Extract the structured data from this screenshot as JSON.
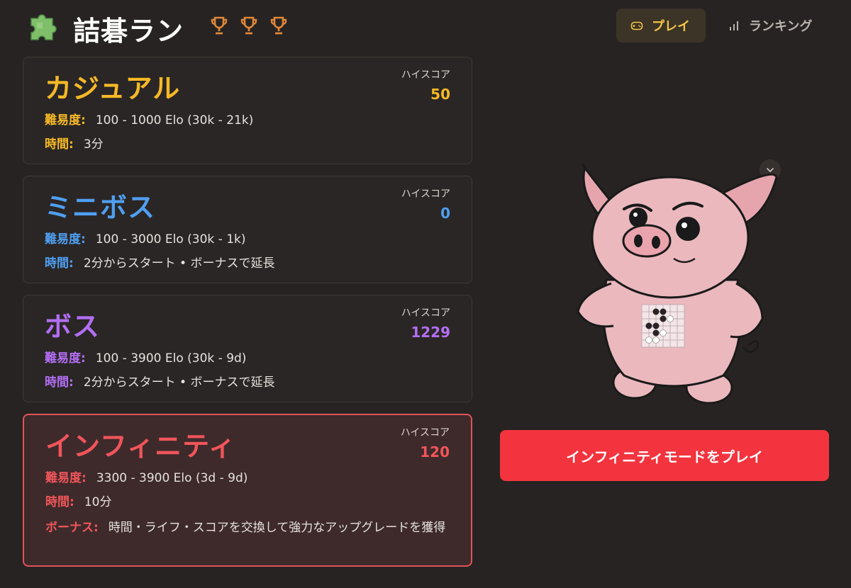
{
  "header": {
    "title": "詰碁ラン",
    "logo_icon": "puzzle-piece-icon",
    "trophy_icon": "trophy-icon",
    "trophy_color": "#e0873a",
    "nav": {
      "play_label": "プレイ",
      "play_icon": "gamepad-icon",
      "ranking_label": "ランキング",
      "ranking_icon": "bar-chart-icon"
    }
  },
  "modes": [
    {
      "id": "casual",
      "title": "カジュアル",
      "color": "#f6b926",
      "highscore_label": "ハイスコア",
      "highscore": "50",
      "difficulty_label": "難易度:",
      "difficulty": "100 - 1000 Elo (30k - 21k)",
      "time_label": "時間:",
      "time": "3分"
    },
    {
      "id": "miniboss",
      "title": "ミニボス",
      "color": "#4f9ff1",
      "highscore_label": "ハイスコア",
      "highscore": "0",
      "difficulty_label": "難易度:",
      "difficulty": "100 - 3000 Elo (30k - 1k)",
      "time_label": "時間:",
      "time": "2分からスタート • ボーナスで延長"
    },
    {
      "id": "boss",
      "title": "ボス",
      "color": "#b36ef4",
      "highscore_label": "ハイスコア",
      "highscore": "1229",
      "difficulty_label": "難易度:",
      "difficulty": "100 - 3900 Elo (30k - 9d)",
      "time_label": "時間:",
      "time": "2分からスタート • ボーナスで延長"
    },
    {
      "id": "infinity",
      "title": "インフィニティ",
      "color": "#f0555a",
      "selected": true,
      "highscore_label": "ハイスコア",
      "highscore": "120",
      "difficulty_label": "難易度:",
      "difficulty": "3300 - 3900 Elo (3d - 9d)",
      "time_label": "時間:",
      "time": "10分",
      "bonus_label": "ボーナス:",
      "bonus": "時間・ライフ・スコアを交換して強力なアップグレードを獲得"
    }
  ],
  "panel": {
    "mascot": "pig-mascot-with-go-board",
    "collapse_icon": "chevron-down-icon",
    "play_button_label": "インフィニティモードをプレイ",
    "play_button_color": "#f3343e"
  }
}
